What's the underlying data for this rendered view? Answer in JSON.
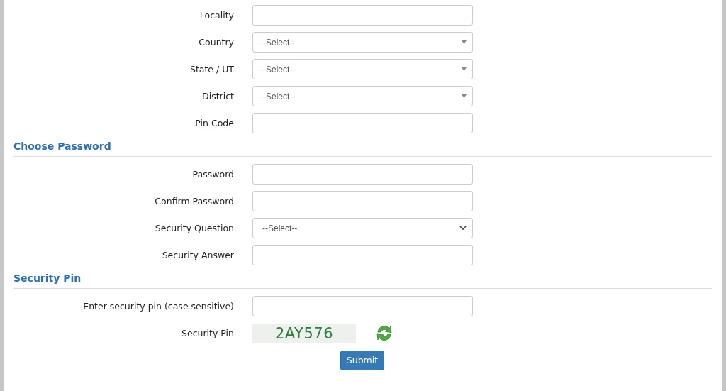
{
  "address_fields": [
    {
      "label": "Locality",
      "kind": "input"
    },
    {
      "label": "Country",
      "kind": "select",
      "value": "--Select--"
    },
    {
      "label": "State / UT",
      "kind": "select",
      "value": "--Select--"
    },
    {
      "label": "District",
      "kind": "select",
      "value": "--Select--"
    },
    {
      "label": "Pin Code",
      "kind": "input"
    }
  ],
  "password_section": {
    "title": "Choose Password",
    "fields": [
      {
        "label": "Password",
        "kind": "input"
      },
      {
        "label": "Confirm Password",
        "kind": "input"
      },
      {
        "label": "Security Question",
        "kind": "dropdown",
        "value": "--Select--"
      },
      {
        "label": "Security Answer",
        "kind": "input"
      }
    ]
  },
  "pin_section": {
    "title": "Security Pin",
    "fields": [
      {
        "label": "Enter security pin (case sensitive)",
        "kind": "input"
      }
    ],
    "captcha": {
      "label": "Security Pin",
      "code": "2AY576"
    }
  },
  "submit_button": "Submit"
}
